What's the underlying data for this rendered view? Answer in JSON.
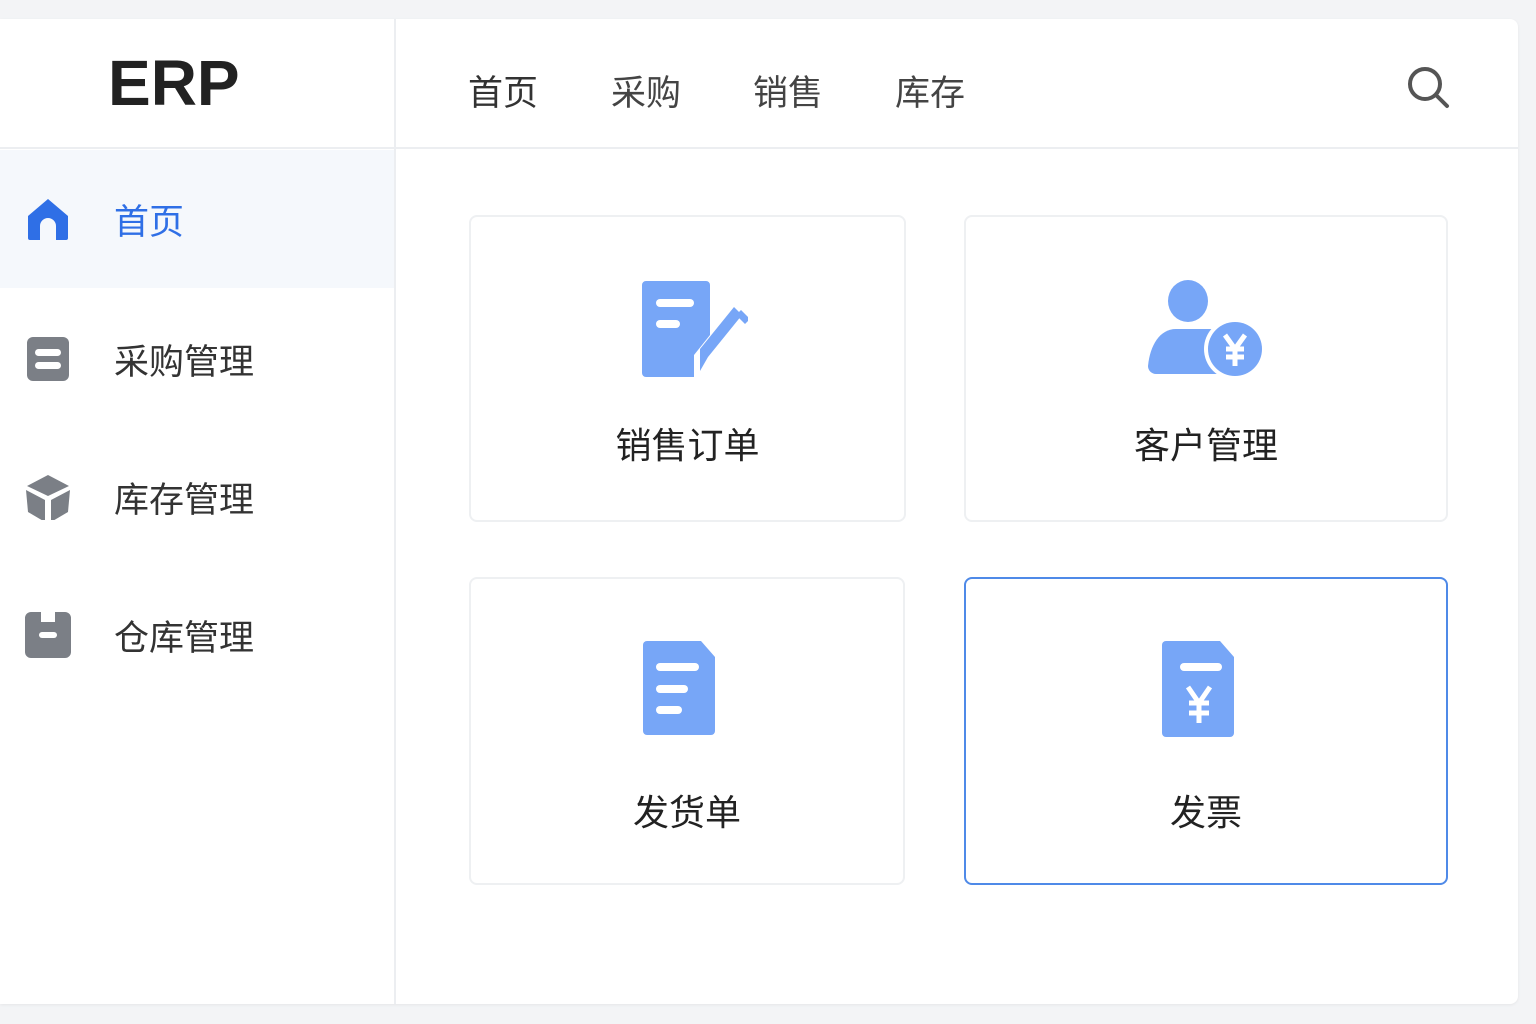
{
  "app": {
    "logo": "ERP"
  },
  "header": {
    "nav": [
      "首页",
      "采购",
      "销售",
      "库存"
    ],
    "search_icon": "search-icon"
  },
  "sidebar": {
    "items": [
      {
        "label": "首页",
        "icon": "home-icon",
        "active": true
      },
      {
        "label": "采购管理",
        "icon": "list-icon"
      },
      {
        "label": "库存管理",
        "icon": "box-icon"
      },
      {
        "label": "仓库管理",
        "icon": "warehouse-icon"
      }
    ]
  },
  "main": {
    "cards": [
      {
        "label": "销售订单",
        "icon": "edit-document-icon"
      },
      {
        "label": "客户管理",
        "icon": "customer-yen-icon"
      },
      {
        "label": "发货单",
        "icon": "document-icon"
      },
      {
        "label": "发票",
        "icon": "invoice-icon",
        "selected": true
      }
    ]
  },
  "colors": {
    "accent": "#2f6fe6",
    "icon_blue": "#77a6f7",
    "icon_gray": "#7b7f86",
    "selected_border": "#4f8ae8"
  }
}
